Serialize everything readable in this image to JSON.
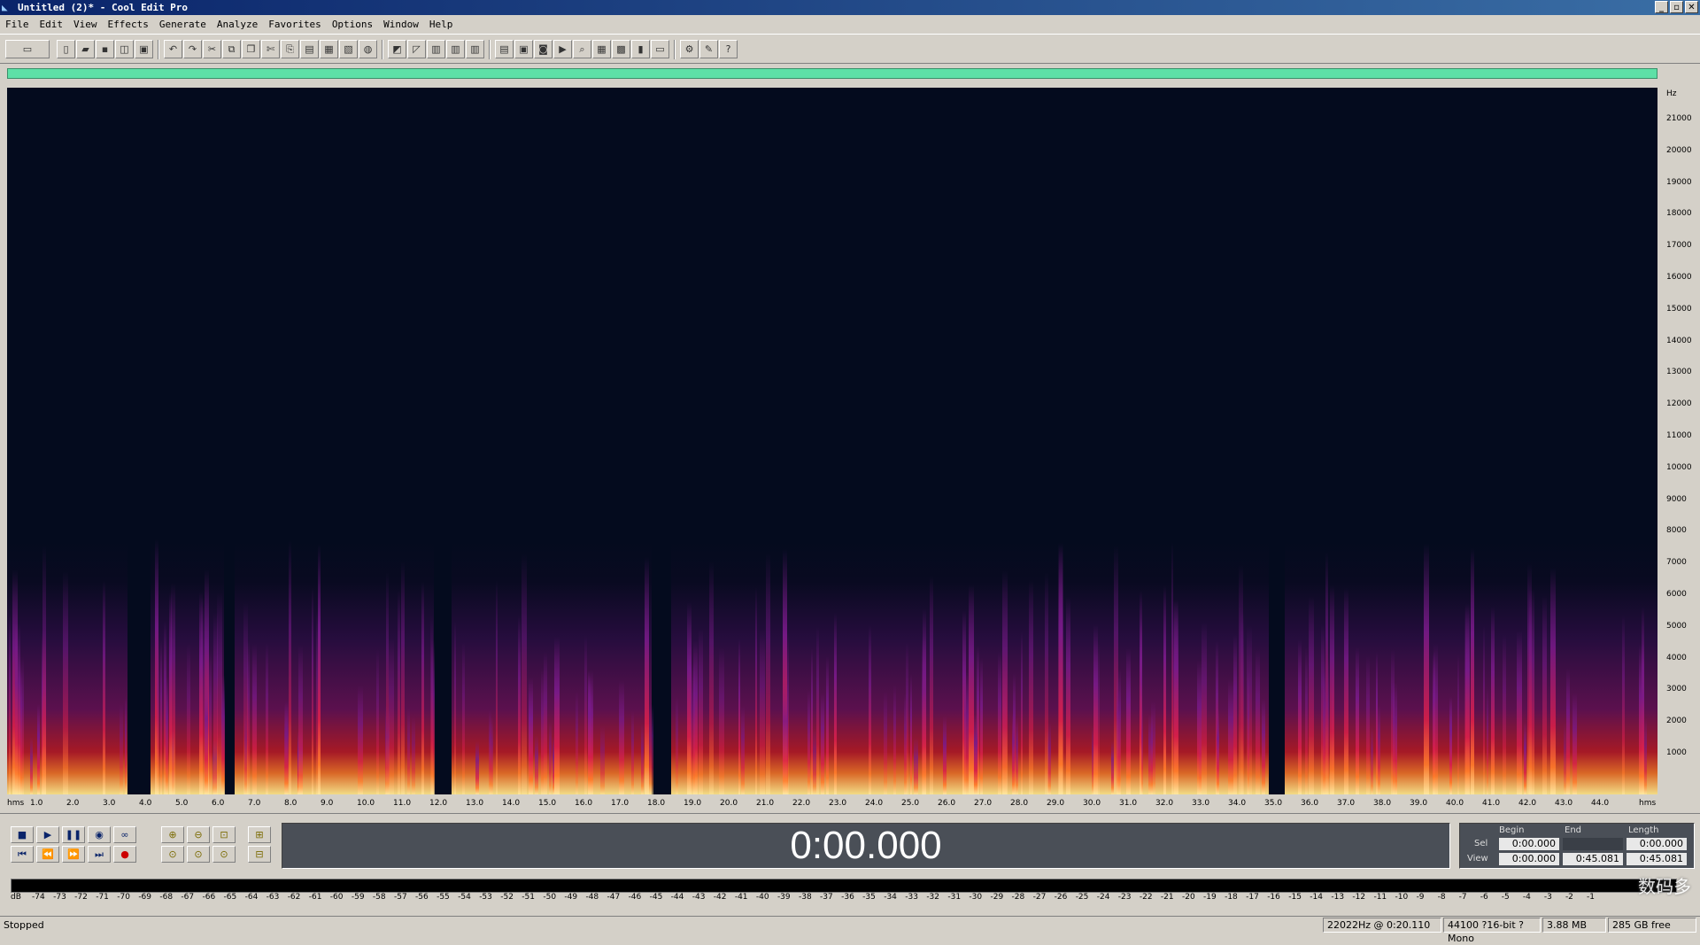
{
  "window": {
    "title": "Untitled (2)* - Cool Edit Pro",
    "min": "_",
    "max": "▫",
    "close": "✕"
  },
  "menu": [
    "File",
    "Edit",
    "View",
    "Effects",
    "Generate",
    "Analyze",
    "Favorites",
    "Options",
    "Window",
    "Help"
  ],
  "freq_axis": {
    "unit": "Hz",
    "ticks": [
      "21000",
      "20000",
      "19000",
      "18000",
      "17000",
      "16000",
      "15000",
      "14000",
      "13000",
      "12000",
      "11000",
      "10000",
      "9000",
      "8000",
      "7000",
      "6000",
      "5000",
      "4000",
      "3000",
      "2000",
      "1000"
    ]
  },
  "time_axis": {
    "start_label": "hms",
    "end_label": "hms",
    "ticks": [
      "1.0",
      "2.0",
      "3.0",
      "4.0",
      "5.0",
      "6.0",
      "7.0",
      "8.0",
      "9.0",
      "10.0",
      "11.0",
      "12.0",
      "13.0",
      "14.0",
      "15.0",
      "16.0",
      "17.0",
      "18.0",
      "19.0",
      "20.0",
      "21.0",
      "22.0",
      "23.0",
      "24.0",
      "25.0",
      "26.0",
      "27.0",
      "28.0",
      "29.0",
      "30.0",
      "31.0",
      "32.0",
      "33.0",
      "34.0",
      "35.0",
      "36.0",
      "37.0",
      "38.0",
      "39.0",
      "40.0",
      "41.0",
      "42.0",
      "43.0",
      "44.0"
    ]
  },
  "time_display": "0:00.000",
  "selection": {
    "headers": {
      "begin": "Begin",
      "end": "End",
      "length": "Length"
    },
    "sel": {
      "label": "Sel",
      "begin": "0:00.000",
      "end": "",
      "length": "0:00.000"
    },
    "view": {
      "label": "View",
      "begin": "0:00.000",
      "end": "0:45.081",
      "length": "0:45.081"
    }
  },
  "level_meter": {
    "ticks": [
      "dB",
      "-74",
      "-73",
      "-72",
      "-71",
      "-70",
      "-69",
      "-68",
      "-67",
      "-66",
      "-65",
      "-64",
      "-63",
      "-62",
      "-61",
      "-60",
      "-59",
      "-58",
      "-57",
      "-56",
      "-55",
      "-54",
      "-53",
      "-52",
      "-51",
      "-50",
      "-49",
      "-48",
      "-47",
      "-46",
      "-45",
      "-44",
      "-43",
      "-42",
      "-41",
      "-40",
      "-39",
      "-38",
      "-37",
      "-36",
      "-35",
      "-34",
      "-33",
      "-32",
      "-31",
      "-30",
      "-29",
      "-28",
      "-27",
      "-26",
      "-25",
      "-24",
      "-23",
      "-22",
      "-21",
      "-20",
      "-19",
      "-18",
      "-17",
      "-16",
      "-15",
      "-14",
      "-13",
      "-12",
      "-11",
      "-10",
      "-9",
      "-8",
      "-7",
      "-6",
      "-5",
      "-4",
      "-3",
      "-2",
      "-1"
    ]
  },
  "watermark": "数码多",
  "status": {
    "state": "Stopped",
    "cursor": "22022Hz @  0:20.110",
    "format": "44100 ?16-bit ?Mono",
    "size": "3.88 MB",
    "free": "285 GB free"
  },
  "colors": {
    "overview": "#5ee0a7",
    "spectrogram_bg": "#040b1e",
    "title_start": "#0a246a",
    "title_end": "#3a6ea5"
  }
}
